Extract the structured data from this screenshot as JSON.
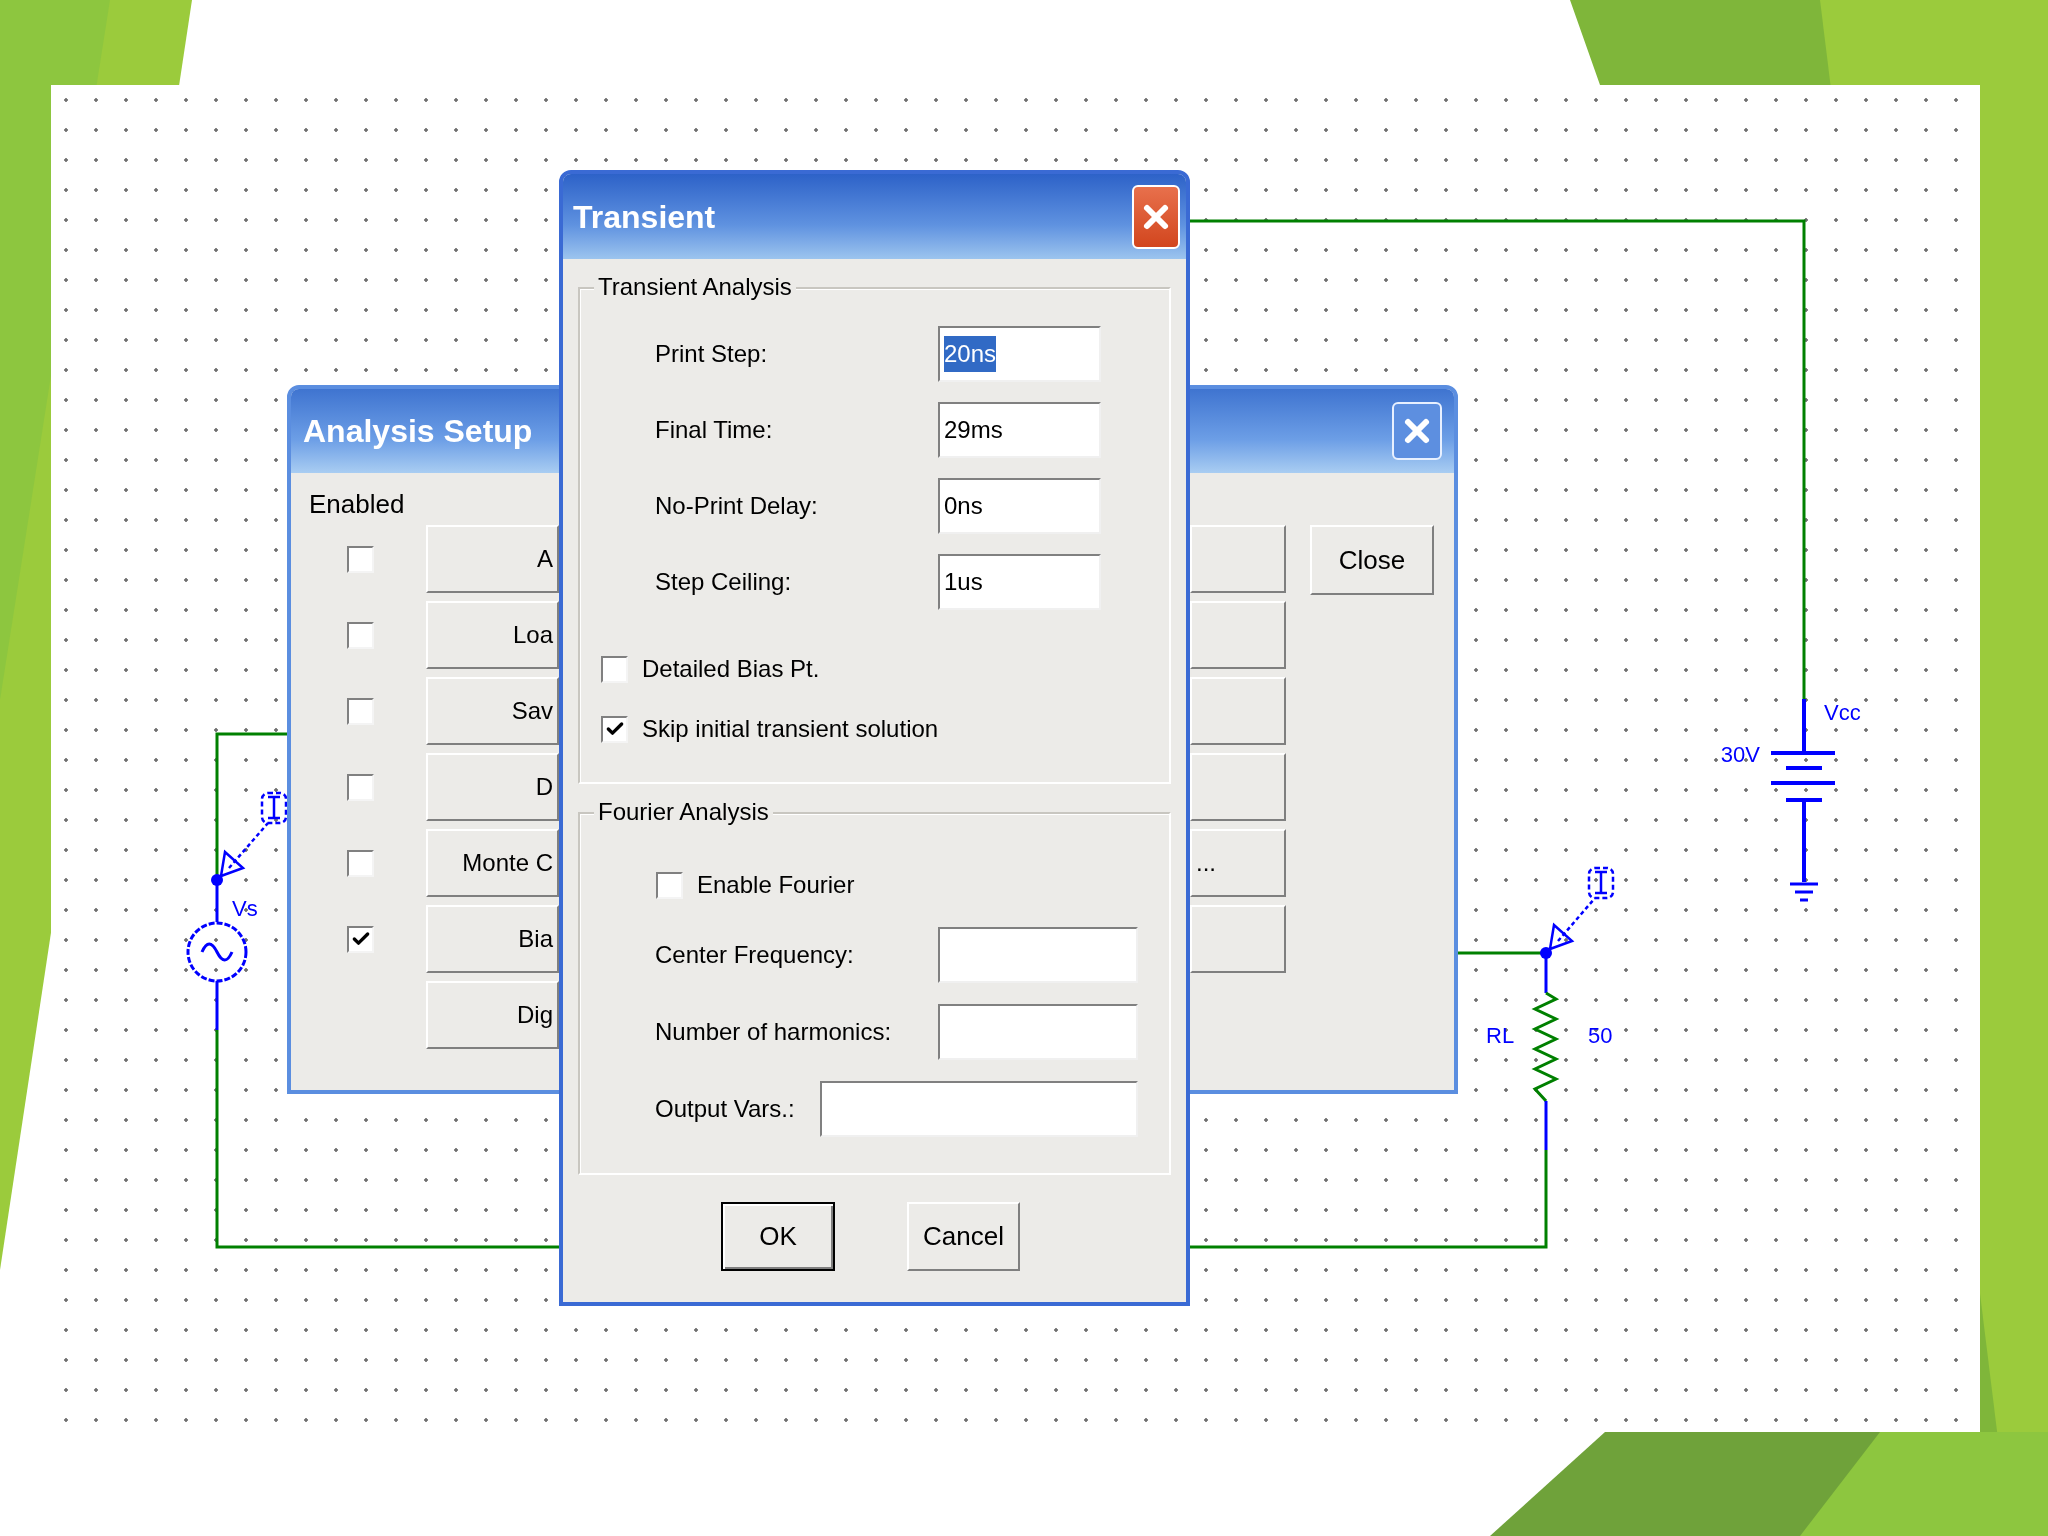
{
  "schematic": {
    "source_label": "Vs",
    "battery_value": "30V",
    "battery_label": "Vcc",
    "resistor_label": "RL",
    "resistor_value": "50"
  },
  "analysis_setup": {
    "title": "Analysis Setup",
    "column_header": "Enabled",
    "rows": [
      {
        "kind": "checkbox_row",
        "enabled": false,
        "label": "A"
      },
      {
        "kind": "checkbox_row",
        "enabled": false,
        "label": "Loa"
      },
      {
        "kind": "checkbox_row",
        "enabled": false,
        "label": "Sav"
      },
      {
        "kind": "checkbox_row",
        "enabled": false,
        "label": "D"
      },
      {
        "kind": "checkbox_row",
        "enabled": false,
        "label": "Monte C",
        "right_label": "..."
      },
      {
        "kind": "checkbox_row",
        "enabled": true,
        "label": "Bia"
      },
      {
        "kind": "plain",
        "label": "Dig"
      }
    ],
    "close_button": "Close"
  },
  "transient": {
    "title": "Transient",
    "analysis_group": {
      "title": "Transient Analysis",
      "fields": [
        {
          "label": "Print Step:",
          "value": "20ns",
          "highlighted": true
        },
        {
          "label": "Final Time:",
          "value": "29ms",
          "highlighted": false
        },
        {
          "label": "No-Print Delay:",
          "value": "0ns",
          "highlighted": false
        },
        {
          "label": "Step Ceiling:",
          "value": "1us",
          "highlighted": false
        }
      ],
      "options": [
        {
          "label": "Detailed Bias Pt.",
          "checked": false
        },
        {
          "label": "Skip initial transient solution",
          "checked": true
        }
      ]
    },
    "fourier_group": {
      "title": "Fourier Analysis",
      "enable": {
        "label": "Enable Fourier",
        "checked": false
      },
      "fields": [
        {
          "label": "Center Frequency:",
          "kind": "short"
        },
        {
          "label": "Number of harmonics:",
          "kind": "short"
        },
        {
          "label": "Output Vars.:",
          "kind": "wide"
        }
      ]
    },
    "buttons": [
      {
        "label": "OK",
        "default": true
      },
      {
        "label": "Cancel",
        "default": false
      }
    ]
  }
}
